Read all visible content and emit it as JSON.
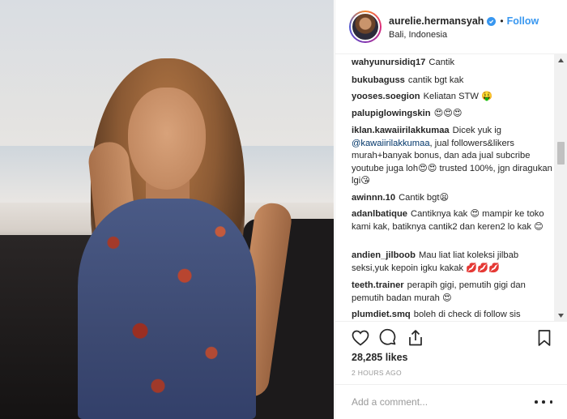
{
  "post": {
    "username": "aurelie.hermansyah",
    "follow_label": "Follow",
    "separator": "•",
    "location": "Bali, Indonesia",
    "likes": "28,285 likes",
    "time": "2 HOURS AGO",
    "comment_placeholder": "Add a comment..."
  },
  "comments": [
    {
      "user": "wahyunursidiq17",
      "text": "Cantik"
    },
    {
      "user": "bukubaguss",
      "text": "cantik bgt kak"
    },
    {
      "user": "yooses.soegion",
      "text": "Keliatan STW 🤑"
    },
    {
      "user": "palupiglowingskin",
      "text": "😍😍😍"
    },
    {
      "user": "iklan.kawaiirilakkumaa",
      "text": "Dicek yuk ig",
      "mention": "@kawaiirilakkumaa",
      "text2": ", jual followers&likers murah+banyak bonus, dan ada jual subcribe youtube juga loh😍😍 trusted 100%, jgn diragukan lgi😘"
    },
    {
      "user": "awinnn.10",
      "text": "Cantik bgt😫"
    },
    {
      "user": "adanlbatique",
      "text": "Cantiknya kak 😍 mampir ke toko kami kak, batiknya cantik2 dan keren2 lo kak 😊"
    },
    {
      "user": "andien_jilboob",
      "text": "Mau liat liat koleksi jilbab seksi,yuk kepoin igku kakak 💋💋💋"
    },
    {
      "user": "teeth.trainer",
      "text": "perapih gigi, pemutih gigi dan pemutih badan murah 😍"
    },
    {
      "user": "plumdiet.smq",
      "text": "boleh di check di follow sis"
    }
  ],
  "icons": {
    "verified": "verified-badge-icon",
    "like": "heart-icon",
    "comment": "comment-bubble-icon",
    "share": "share-icon",
    "save": "bookmark-icon",
    "more": "more-options-icon"
  },
  "colors": {
    "accent": "#3897f0",
    "text": "#262626",
    "muted": "#999999",
    "border": "#efefef"
  }
}
